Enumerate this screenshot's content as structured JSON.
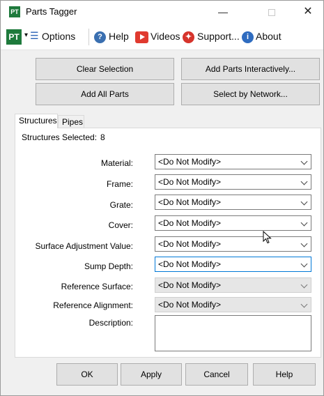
{
  "window": {
    "title": "Parts Tagger",
    "app_icon_text": "PT",
    "minimize_glyph": "—",
    "close_glyph": "✕"
  },
  "toolbar": {
    "logo_text": "PT",
    "caret": "▾",
    "options_icon_glyph": "☰",
    "options_label": "Options",
    "help_label": "Help",
    "help_icon_glyph": "?",
    "videos_label": "Videos",
    "support_label": "Support...",
    "support_icon_glyph": "✦",
    "about_label": "About",
    "about_icon_glyph": "i"
  },
  "actions": {
    "clear_selection": "Clear Selection",
    "add_parts_interactively": "Add Parts Interactively...",
    "add_all_parts": "Add All Parts",
    "select_by_network": "Select by Network..."
  },
  "tabs": [
    {
      "label": "Structures",
      "active": true
    },
    {
      "label": "Pipes",
      "active": false
    }
  ],
  "structures": {
    "selected_label": "Structures Selected:",
    "selected_count": "8",
    "fields": [
      {
        "label": "Material:",
        "value": "<Do Not Modify>",
        "state": "normal"
      },
      {
        "label": "Frame:",
        "value": "<Do Not Modify>",
        "state": "normal"
      },
      {
        "label": "Grate:",
        "value": "<Do Not Modify>",
        "state": "normal"
      },
      {
        "label": "Cover:",
        "value": "<Do Not Modify>",
        "state": "normal"
      },
      {
        "label": "Surface Adjustment Value:",
        "value": "<Do Not Modify>",
        "state": "normal"
      },
      {
        "label": "Sump Depth:",
        "value": "<Do Not Modify>",
        "state": "focused"
      },
      {
        "label": "Reference Surface:",
        "value": "<Do Not Modify>",
        "state": "disabled"
      },
      {
        "label": "Reference Alignment:",
        "value": "<Do Not Modify>",
        "state": "disabled"
      }
    ],
    "description_label": "Description:",
    "description_value": ""
  },
  "footer": {
    "ok": "OK",
    "apply": "Apply",
    "cancel": "Cancel",
    "help": "Help"
  },
  "colors": {
    "accent_focus": "#0078d7",
    "brand_green": "#1e7a3c",
    "videos_red": "#e03a2f",
    "help_blue": "#3a6fb0"
  }
}
